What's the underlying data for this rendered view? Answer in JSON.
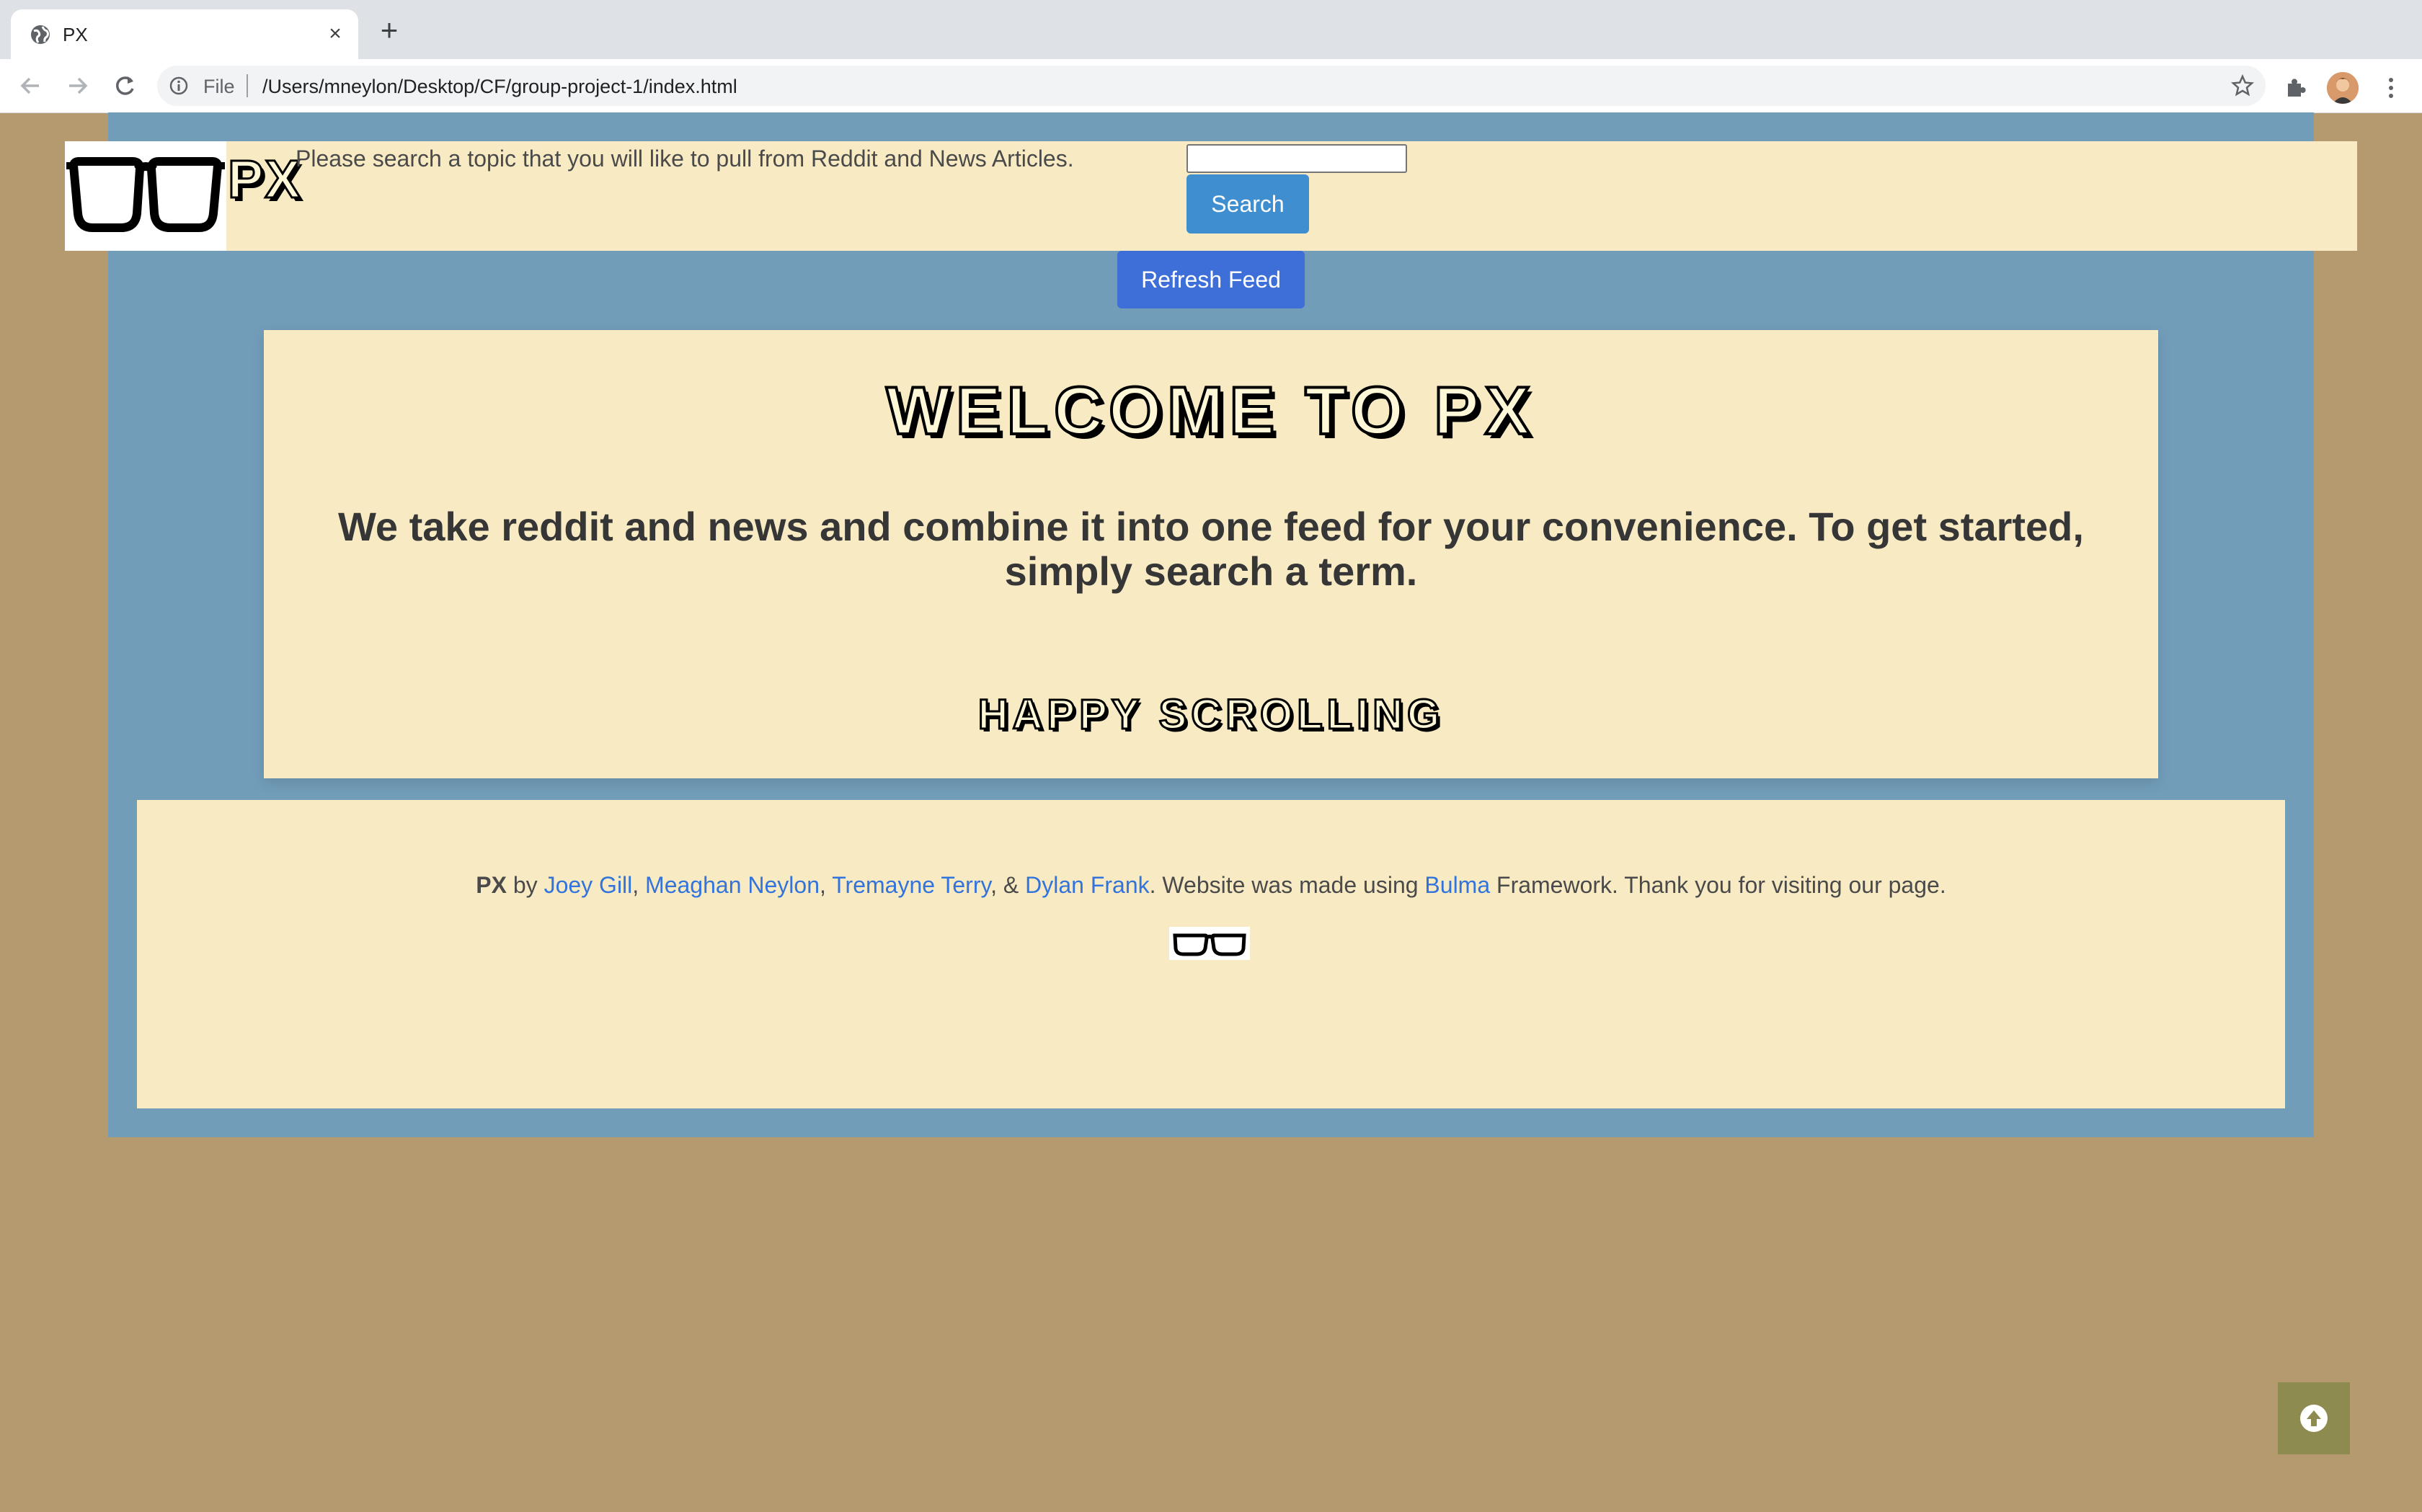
{
  "browser": {
    "tab_title": "PX",
    "tab_close": "×",
    "new_tab": "+",
    "url_scheme_label": "File",
    "url": "/Users/mneylon/Desktop/CF/group-project-1/index.html"
  },
  "header": {
    "brand": "PX",
    "search_prompt": "Please search a topic that you will like to pull from Reddit and News Articles.",
    "search_input_value": "",
    "search_button": "Search",
    "refresh_button": "Refresh Feed"
  },
  "welcome": {
    "title": "WELCOME TO PX",
    "subtitle": "We take reddit and news and combine it into one feed for your convenience. To get started, simply search a term.",
    "tagline": "HAPPY SCROLLING"
  },
  "footer": {
    "brand": "PX",
    "by": " by ",
    "authors": [
      "Joey Gill",
      "Meaghan Neylon",
      "Tremayne Terry",
      "Dylan Frank"
    ],
    "sep_comma": ", ",
    "sep_amp": ", & ",
    "made_using": ". Website was made using ",
    "framework": "Bulma",
    "closing": " Framework. Thank you for visiting our page."
  },
  "colors": {
    "page_bg": "#b59a70",
    "wrap_bg": "#729db9",
    "card_bg": "#f8ebc4",
    "primary_button": "#3e8ed0",
    "link": "#3273dc",
    "scroll_top_bg": "#8e8b50"
  },
  "icons": [
    "globe-icon",
    "close-icon",
    "plus-icon",
    "back-arrow-icon",
    "forward-arrow-icon",
    "reload-icon",
    "info-icon",
    "star-icon",
    "puzzle-extension-icon",
    "kebab-menu-icon",
    "glasses-logo-icon",
    "arrow-up-circle-icon"
  ]
}
